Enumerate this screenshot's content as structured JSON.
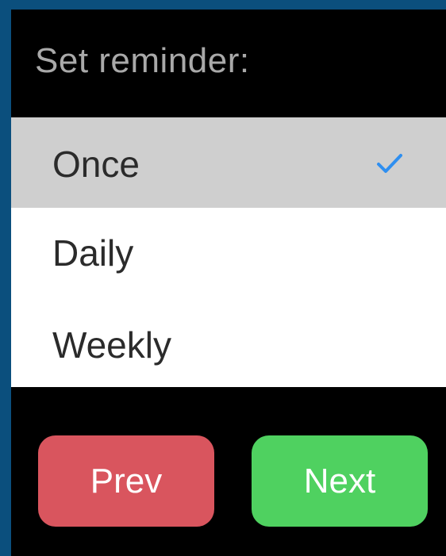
{
  "title": "Set reminder:",
  "options": [
    {
      "label": "Once",
      "selected": true
    },
    {
      "label": "Daily",
      "selected": false
    },
    {
      "label": "Weekly",
      "selected": false
    }
  ],
  "icons": {
    "selected_indicator": "checkmark-icon"
  },
  "buttons": {
    "prev_label": "Prev",
    "next_label": "Next"
  },
  "colors": {
    "selected_row": "#cfcfcf",
    "check": "#2f8ff0",
    "prev": "#d9555e",
    "next": "#4fd160"
  }
}
